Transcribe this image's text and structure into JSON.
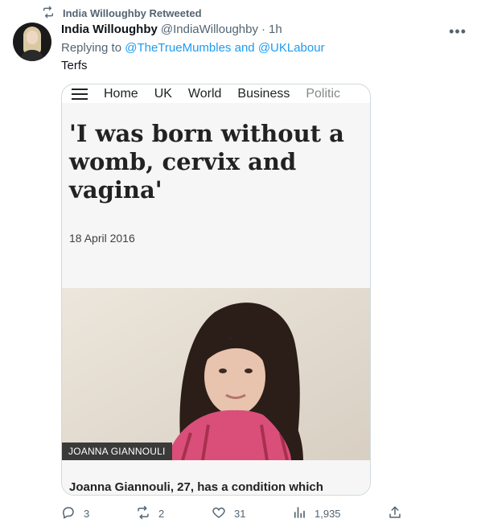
{
  "retweet": {
    "label": "India Willoughby Retweeted",
    "icon": "retweet-icon"
  },
  "tweet": {
    "display_name": "India Willoughby",
    "handle": "@IndiaWilloughby",
    "separator": "·",
    "time": "1h",
    "replying_prefix": "Replying to",
    "replying_mention_1": "@TheTrueMumbles",
    "replying_and": "and",
    "replying_mention_2": "@UKLabour",
    "text": "Terfs",
    "more_icon": "more-icon"
  },
  "card": {
    "nav": [
      "Home",
      "UK",
      "World",
      "Business",
      "Politic"
    ],
    "headline": "'I was born without a womb, cervix and vagina'",
    "date": "18 April 2016",
    "caption": "JOANNA GIANNOULI",
    "lead": "Joanna Giannouli, 27, has a condition which"
  },
  "actions": {
    "reply_count": "3",
    "retweet_count": "2",
    "like_count": "31",
    "views_count": "1,935"
  },
  "colors": {
    "accent": "#1d9bf0",
    "secondary_text": "#536471",
    "border": "#cfd9de"
  }
}
